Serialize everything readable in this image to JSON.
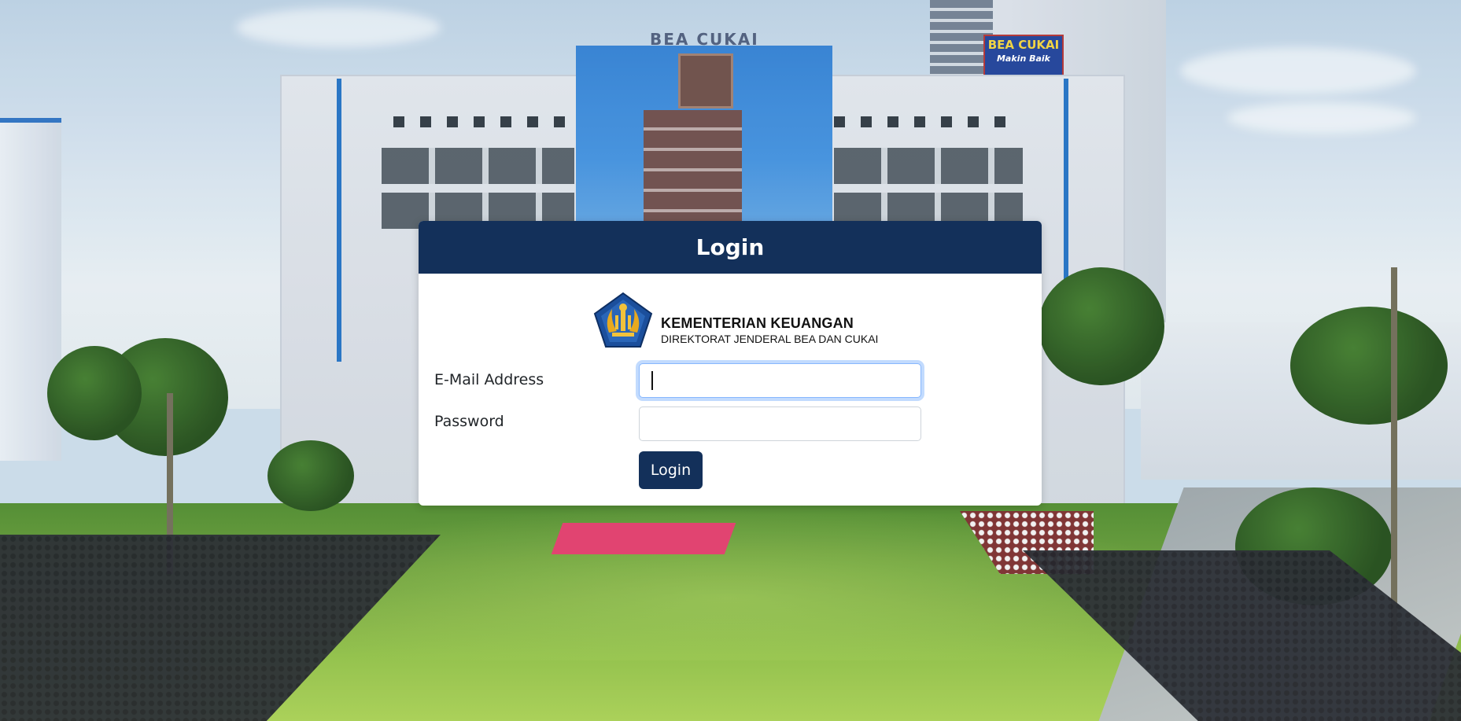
{
  "background": {
    "roof_sign": "BEA CUKAI",
    "billboard_title": "BEA CUKAI",
    "billboard_sub": "Makin Baik"
  },
  "login": {
    "title": "Login",
    "logo": {
      "icon": "kemenkeu-emblem-icon",
      "line1": "KEMENTERIAN KEUANGAN",
      "line2": "DIREKTORAT JENDERAL BEA DAN CUKAI"
    },
    "email": {
      "label": "E-Mail Address",
      "value": "",
      "placeholder": ""
    },
    "password": {
      "label": "Password",
      "value": "",
      "placeholder": ""
    },
    "submit_label": "Login"
  },
  "colors": {
    "header_bg": "#13305a",
    "button_bg": "#13305a",
    "focus_ring": "#86b7fe",
    "emblem_blue": "#1b4f9c",
    "emblem_gold": "#e8a91e"
  }
}
